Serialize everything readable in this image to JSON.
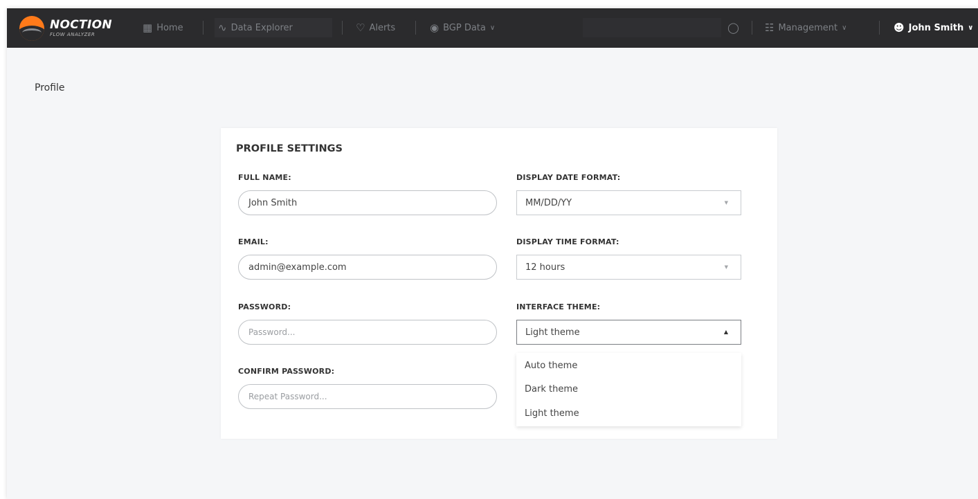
{
  "brand": {
    "name": "NOCTION",
    "product": "FLOW ANALYZER"
  },
  "nav": {
    "home": "Home",
    "data_explorer": "Data Explorer",
    "alerts": "Alerts",
    "bgp_data": "BGP Data",
    "management": "Management",
    "user": "John Smith"
  },
  "page": {
    "title": "Profile"
  },
  "profile": {
    "heading": "PROFILE SETTINGS",
    "full_name_label": "FULL NAME:",
    "full_name_value": "John Smith",
    "email_label": "EMAIL:",
    "email_value": "admin@example.com",
    "password_label": "PASSWORD:",
    "password_placeholder": "Password...",
    "confirm_password_label": "CONFIRM PASSWORD:",
    "confirm_password_placeholder": "Repeat Password...",
    "date_format_label": "DISPLAY DATE FORMAT:",
    "date_format_value": "MM/DD/YY",
    "time_format_label": "DISPLAY TIME FORMAT:",
    "time_format_value": "12 hours",
    "theme_label": "INTERFACE THEME:",
    "theme_value": "Light theme",
    "theme_options": [
      "Auto theme",
      "Dark theme",
      "Light theme"
    ]
  },
  "colors": {
    "topbar": "#2b2b2d",
    "accent": "#ff7a1a",
    "page_bg": "#f5f6f8"
  }
}
